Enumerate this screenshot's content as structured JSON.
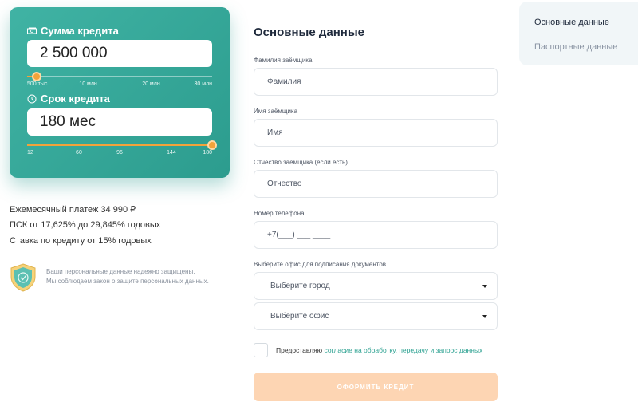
{
  "calculator": {
    "amount_label": "Сумма кредита",
    "amount_value": "2 500 000",
    "amount_ticks": [
      "500 тыс",
      "10 млн",
      "20 млн",
      "30 млн"
    ],
    "amount_fraction": 0.05,
    "term_label": "Срок кредита",
    "term_value": "180 мес",
    "term_ticks": [
      "12",
      "60",
      "96",
      "144",
      "180"
    ],
    "term_fraction": 1.0
  },
  "summary": {
    "monthly": "Ежемесячный платеж 34 990 ₽",
    "psk": "ПСК от 17,625% до 29,845% годовых",
    "rate": "Ставка по кредиту от 15% годовых"
  },
  "security": {
    "line1": "Ваши персональные данные надежно защищены.",
    "line2": "Мы соблюдаем закон о защите персональных данных."
  },
  "form": {
    "title": "Основные данные",
    "surname_label": "Фамилия заёмщика",
    "surname_placeholder": "Фамилия",
    "name_label": "Имя заёмщика",
    "name_placeholder": "Имя",
    "patronymic_label": "Отчество заёмщика (если есть)",
    "patronymic_placeholder": "Отчество",
    "phone_label": "Номер телефона",
    "phone_placeholder": "+7(___) ___ ____",
    "office_label": "Выберите офис для подписания документов",
    "city_select": "Выберите город",
    "office_select": "Выберите офис",
    "consent_prefix": "Предоставляю",
    "consent_link": "согласие на обработку, передачу и запрос данных",
    "submit_label": "ОФОРМИТЬ КРЕДИТ"
  },
  "steps": {
    "active": "Основные данные",
    "inactive": "Паспортные данные"
  },
  "colors": {
    "accent": "#2ea292",
    "card": "#40b3a4",
    "slider": "#f2a33a",
    "submit": "#fdd5b3"
  }
}
